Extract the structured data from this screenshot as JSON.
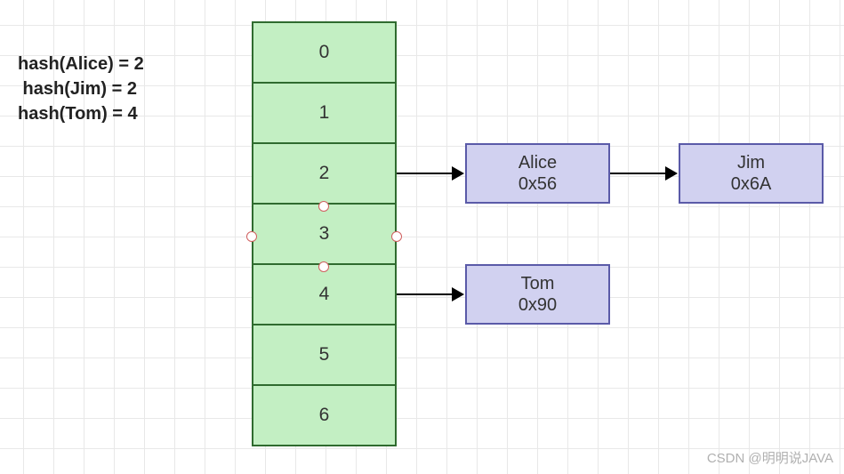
{
  "hash_lines": {
    "l0": "hash(Alice) = 2",
    "l1": " hash(Jim) = 2",
    "l2": "hash(Tom) = 4"
  },
  "array": {
    "cells": [
      "0",
      "1",
      "2",
      "3",
      "4",
      "5",
      "6"
    ]
  },
  "nodes": {
    "n0": {
      "name": "Alice",
      "addr": "0x56"
    },
    "n1": {
      "name": "Jim",
      "addr": "0x6A"
    },
    "n2": {
      "name": "Tom",
      "addr": "0x90"
    }
  },
  "watermark": "CSDN @明明说JAVA",
  "chart_data": {
    "type": "diagram",
    "description": "Hash table with separate chaining",
    "hash_function": [
      {
        "key": "Alice",
        "hash": 2
      },
      {
        "key": "Jim",
        "hash": 2
      },
      {
        "key": "Tom",
        "hash": 4
      }
    ],
    "buckets": 7,
    "chains": {
      "2": [
        {
          "name": "Alice",
          "address": "0x56"
        },
        {
          "name": "Jim",
          "address": "0x6A"
        }
      ],
      "4": [
        {
          "name": "Tom",
          "address": "0x90"
        }
      ]
    }
  }
}
